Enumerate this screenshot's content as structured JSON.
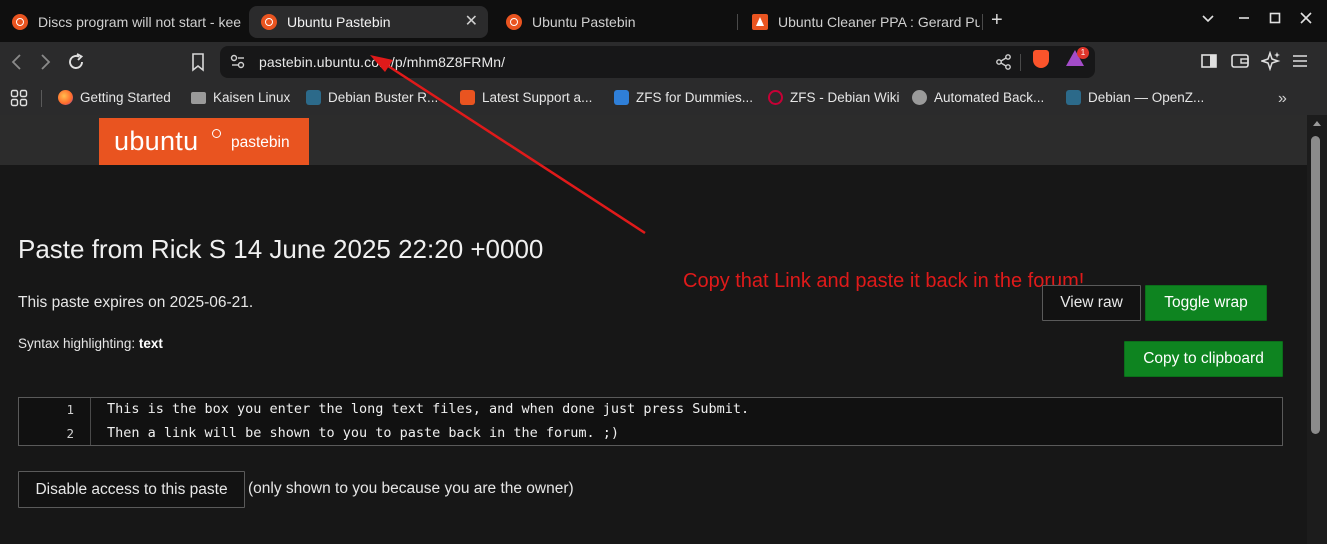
{
  "browser": {
    "tabs": [
      {
        "title": "Discs program will not start - kee",
        "active": false
      },
      {
        "title": "Ubuntu Pastebin",
        "active": true
      },
      {
        "title": "Ubuntu Pastebin",
        "active": false
      },
      {
        "title": "Ubuntu Cleaner PPA : Gerard Pu",
        "active": false
      }
    ],
    "url": "pastebin.ubuntu.com/p/mhm8Z8FRMn/",
    "rewards_badge": "1",
    "bookmarks": [
      "Getting Started",
      "Kaisen Linux",
      "Debian Buster R...",
      "Latest Support a...",
      "ZFS for Dummies...",
      "ZFS - Debian Wiki",
      "Automated Back...",
      "Debian — OpenZ..."
    ]
  },
  "site": {
    "logo_word": "ubuntu",
    "logo_sub": "pastebin",
    "brand_color": "#E95420"
  },
  "paste": {
    "title": "Paste from Rick S 14 June 2025 22:20 +0000",
    "expires": "This paste expires on 2025-06-21.",
    "syntax_label": "Syntax highlighting:",
    "syntax_value": "text",
    "view_raw": "View raw",
    "toggle_wrap": "Toggle wrap",
    "copy_clipboard": "Copy to clipboard",
    "lines": [
      {
        "n": "1",
        "text": "This is the box you enter the long text files, and when done just press Submit."
      },
      {
        "n": "2",
        "text": "Then a link will be shown to you to paste back in the forum. ;)"
      }
    ],
    "disable_access": "Disable access to this paste",
    "owner_note": "(only shown to you because you are the owner)"
  },
  "annotation": {
    "text": "Copy that Link and paste it back in the forum!",
    "color": "#E01A1A"
  }
}
